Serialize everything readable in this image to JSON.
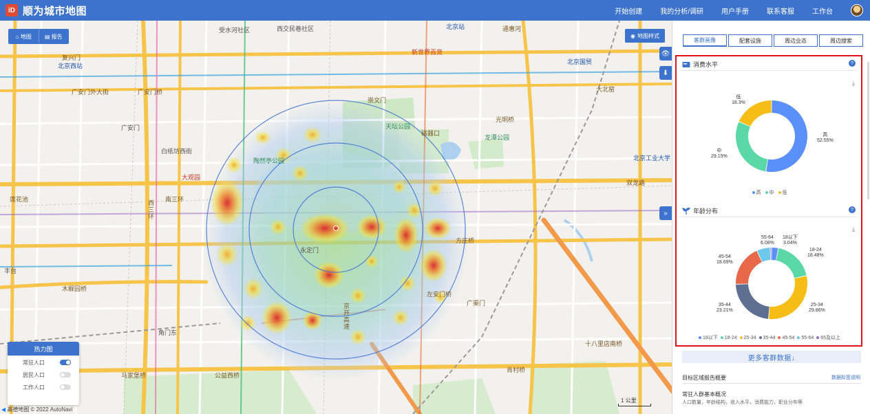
{
  "app": {
    "logo_text": "iD",
    "title": "顺为城市地图"
  },
  "top_nav": [
    "开始创建",
    "我的分析/调研",
    "用户手册",
    "联系客服",
    "工作台"
  ],
  "view_toggle": {
    "map": "地图",
    "report": "报告"
  },
  "map_style_button": "地图样式",
  "map_labels": [
    "受水河社区",
    "西交民巷社区",
    "北京站",
    "通惠河",
    "复兴门",
    "北京西站",
    "广安门外大街",
    "广安门桥",
    "广安门",
    "白纸坊西街",
    "大观园",
    "南三环",
    "新世界百货",
    "北京国贸",
    "天坛公园",
    "龙潭公园",
    "光明桥",
    "双龙路",
    "北京工业大学",
    "方庄桥",
    "永定门",
    "木樨园桥",
    "马家堡桥",
    "公益西桥",
    "十八里店南桥",
    "肖村桥",
    "角门东",
    "广渠门",
    "左安门桥",
    "磁器口",
    "崇文门",
    "大北窑",
    "丰台",
    "西三环",
    "京开高速",
    "莲花池",
    "陶然亭公园"
  ],
  "heat_legend": {
    "title": "热力图",
    "rows": [
      {
        "label": "常驻人口",
        "on": true
      },
      {
        "label": "居民人口",
        "on": false
      },
      {
        "label": "工作人口",
        "on": false
      }
    ]
  },
  "map_footer": {
    "copyright": "高德地图 © 2022 AutoNavi",
    "scale": "1 公里"
  },
  "panel": {
    "tabs": [
      {
        "label": "客群画像",
        "active": true
      },
      {
        "label": "配套设施",
        "active": false
      },
      {
        "label": "周边业态",
        "active": false
      },
      {
        "label": "周边搜索",
        "active": false
      }
    ],
    "consumption": {
      "title": "消费水平",
      "help": "?",
      "download_icon": "download-icon",
      "slices": [
        {
          "name": "高",
          "value": 52.55,
          "label": "52.55%",
          "color": "#5b8ff9"
        },
        {
          "name": "中",
          "value": 29.15,
          "label": "29.15%",
          "color": "#5ad8a6"
        },
        {
          "name": "低",
          "value": 18.3,
          "label": "18.3%",
          "color": "#f6bd16"
        }
      ],
      "legend": [
        "高",
        "中",
        "低"
      ]
    },
    "age": {
      "title": "年龄分布",
      "help": "?",
      "slices": [
        {
          "name": "18以下",
          "value": 3.04,
          "label": "3.04%",
          "color": "#5b8ff9"
        },
        {
          "name": "18-24",
          "value": 18.48,
          "label": "18.48%",
          "color": "#5ad8a6"
        },
        {
          "name": "25-34",
          "value": 29.86,
          "label": "29.86%",
          "color": "#f6bd16"
        },
        {
          "name": "35-44",
          "value": 23.21,
          "label": "23.21%",
          "color": "#5d7092"
        },
        {
          "name": "45-54",
          "value": 18.69,
          "label": "18.69%",
          "color": "#e8684a"
        },
        {
          "name": "55-64",
          "value": 6.08,
          "label": "6.08%",
          "color": "#6dc8ec"
        },
        {
          "name": "65及以上",
          "value": 0.64,
          "label": "",
          "color": "#9270ca"
        }
      ],
      "legend": [
        "18以下",
        "18-24",
        "25-34",
        "35-44",
        "45-54",
        "55-64",
        "65及以上"
      ]
    },
    "more_button": "更多客群数据↓",
    "summary": {
      "title": "目标区域报告概要",
      "link": "数据标签说明",
      "subtitle": "常驻人群基本概况",
      "text": "人口数量，年龄结构，收入水平，消费能力，职业分布等"
    }
  }
}
